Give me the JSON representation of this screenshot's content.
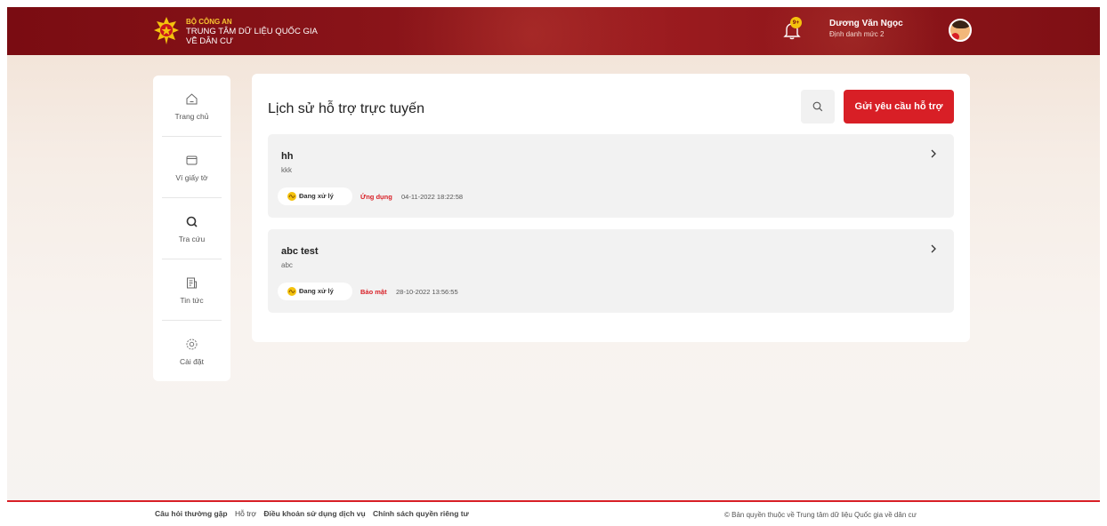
{
  "header": {
    "org_line1": "BỘ CÔNG AN",
    "org_line2": "TRUNG TÂM DỮ LIỆU QUỐC GIA",
    "org_line3": "VỀ DÂN CƯ",
    "notification_badge": "9+",
    "user_name": "Dương Văn Ngọc",
    "user_level": "Định danh mức 2",
    "brand_color": "#8c151a",
    "accent_color": "#f4c20d"
  },
  "sidebar": {
    "items": [
      {
        "label": "Trang chủ",
        "icon": "home-icon"
      },
      {
        "label": "Ví giấy tờ",
        "icon": "wallet-icon"
      },
      {
        "label": "Tra cứu",
        "icon": "search-icon"
      },
      {
        "label": "Tin tức",
        "icon": "news-icon"
      },
      {
        "label": "Cài đặt",
        "icon": "settings-icon"
      }
    ]
  },
  "main": {
    "title": "Lịch sử hỗ trợ trực tuyến",
    "submit_button": "Gửi yêu cầu hỗ trợ",
    "primary_color": "#d81f26",
    "tickets": [
      {
        "title": "hh",
        "description": "kkk",
        "status": "Đang xử lý",
        "category": "Ứng dụng",
        "time": "04-11-2022 18:22:58"
      },
      {
        "title": "abc test",
        "description": "abc",
        "status": "Đang xử lý",
        "category": "Bảo mật",
        "time": "28-10-2022 13:56:55"
      }
    ]
  },
  "footer": {
    "links": [
      "Câu hỏi thường gặp",
      "Hỗ trợ",
      "Điều khoản sử dụng dịch vụ",
      "Chính sách quyền riêng tư"
    ],
    "copyright": "© Bản quyền thuộc về Trung tâm dữ liệu Quốc gia về dân cư"
  }
}
